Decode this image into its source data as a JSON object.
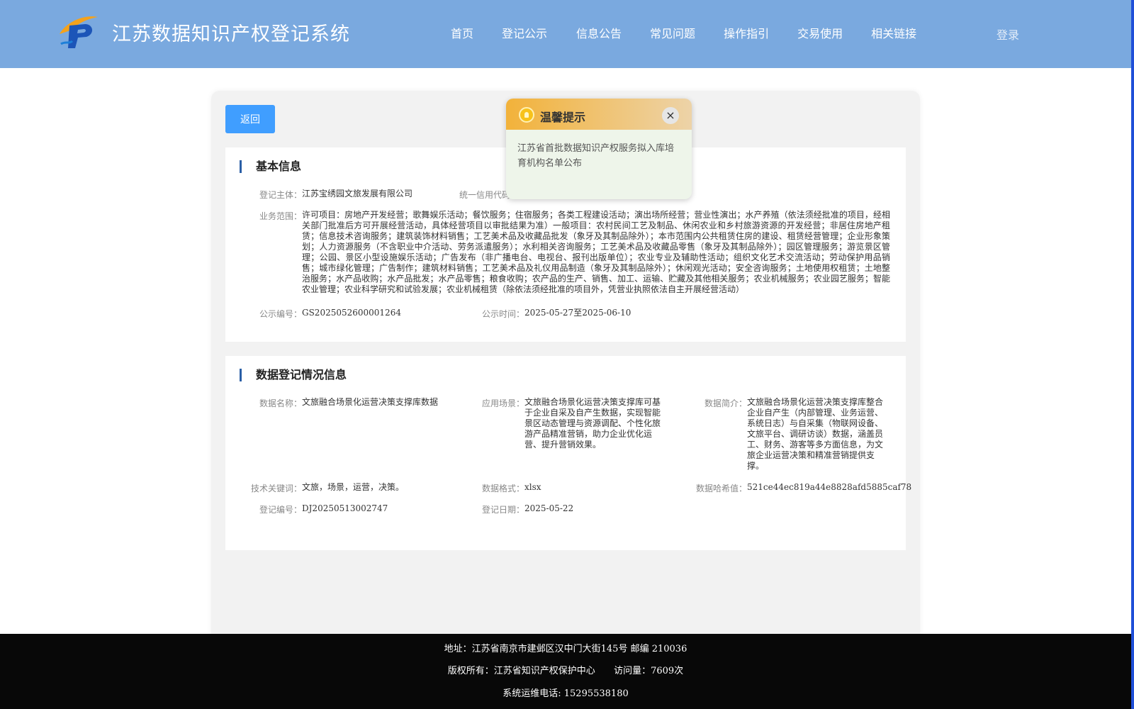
{
  "header": {
    "site_title": "江苏数据知识产权登记系统",
    "nav": [
      "首页",
      "登记公示",
      "信息公告",
      "常见问题",
      "操作指引",
      "交易使用",
      "相关链接"
    ],
    "login": "登录"
  },
  "card": {
    "back_label": "返回",
    "basic": {
      "title": "基本信息",
      "subject_label": "登记主体：",
      "subject": "江苏宝绣园文旅发展有限公司",
      "credit_label": "统一信用代码：",
      "scope_label": "业务范围：",
      "scope": "许可项目：房地产开发经营；歌舞娱乐活动；餐饮服务；住宿服务；各类工程建设活动；演出场所经营；营业性演出；水产养殖（依法须经批准的项目，经相关部门批准后方可开展经营活动，具体经营项目以审批结果为准）一般项目：农村民间工艺及制品、休闲农业和乡村旅游资源的开发经营；非居住房地产租赁；信息技术咨询服务；建筑装饰材料销售；工艺美术品及收藏品批发（象牙及其制品除外）；本市范围内公共租赁住房的建设、租赁经营管理；企业形象策划；人力资源服务（不含职业中介活动、劳务派遣服务）；水利相关咨询服务；工艺美术品及收藏品零售（象牙及其制品除外）；园区管理服务；游览景区管理；公园、景区小型设施娱乐活动；广告发布（非广播电台、电视台、报刊出版单位）；农业专业及辅助性活动；组织文化艺术交流活动；劳动保护用品销售；城市绿化管理；广告制作；建筑材料销售；工艺美术品及礼仪用品制造（象牙及其制品除外）；休闲观光活动；安全咨询服务；土地使用权租赁；土地整治服务；水产品收购；水产品批发；水产品零售；粮食收购；农产品的生产、销售、加工、运输、贮藏及其他相关服务；农业机械服务；农业园艺服务；智能农业管理；农业科学研究和试验发展；农业机械租赁（除依法须经批准的项目外，凭营业执照依法自主开展经营活动）",
      "notice_no_label": "公示编号：",
      "notice_no": "GS2025052600001264",
      "notice_time_label": "公示时间：",
      "notice_time": "2025-05-27至2025-06-10"
    },
    "data_reg": {
      "title": "数据登记情况信息",
      "name_label": "数据名称：",
      "name": "文旅融合场景化运营决策支撑库数据",
      "scene_label": "应用场景：",
      "scene": "文旅融合场景化运营决策支撑库可基于企业自采及自产生数据，实现智能景区动态管理与资源调配、个性化旅游产品精准营销，助力企业优化运营、提升营销效果。",
      "intro_label": "数据简介：",
      "intro": "文旅融合场景化运营决策支撑库整合企业自产生（内部管理、业务运营、系统日志）与自采集（物联网设备、文旅平台、调研访谈）数据，涵盖员工、财务、游客等多方面信息，为文旅企业运营决策和精准营销提供支撑。",
      "keywords_label": "技术关键词：",
      "keywords": "文旅，场景，运营，决策。",
      "format_label": "数据格式：",
      "format": "xlsx",
      "hash_label": "数据哈希值：",
      "hash": "521ce44ec819a44e8828afd5885caf78",
      "reg_no_label": "登记编号：",
      "reg_no": "DJ20250513002747",
      "reg_date_label": "登记日期：",
      "reg_date": "2025-05-22"
    }
  },
  "popup": {
    "title": "温馨提示",
    "close": "×",
    "body": "江苏省首批数据知识产权服务拟入库培育机构名单公布"
  },
  "footer": {
    "address": "地址：江苏省南京市建邺区汉中门大街145号 邮编 210036",
    "copyright": "版权所有：江苏省知识产权保护中心",
    "visits": "访问量：7609次",
    "phone": "系统运维电话: 15295538180"
  },
  "colors": {
    "header_bg": "#7aa9df",
    "button_blue": "#409eff",
    "footer_bg": "#080808",
    "title_bar": "#2b5fa6"
  }
}
